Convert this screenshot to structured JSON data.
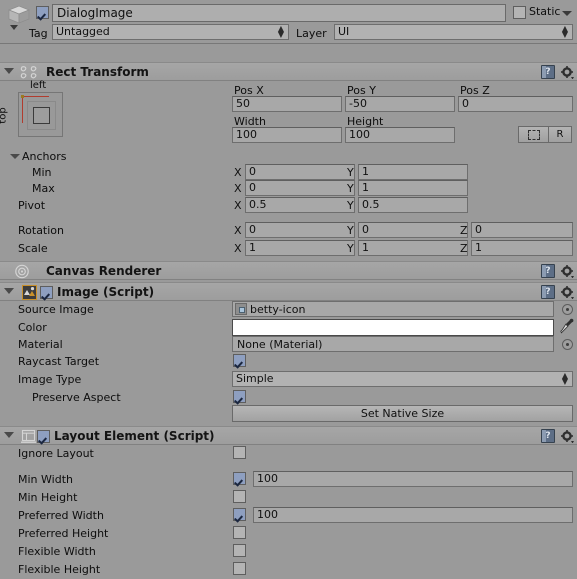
{
  "header": {
    "icon": "cube-icon",
    "enabled": true,
    "name": "DialogImage",
    "static_label": "Static",
    "static_checked": false,
    "tag_label": "Tag",
    "tag_value": "Untagged",
    "layer_label": "Layer",
    "layer_value": "UI"
  },
  "rect_transform": {
    "title": "Rect Transform",
    "anchor_preset_left": "left",
    "anchor_preset_top": "top",
    "pos_x_label": "Pos X",
    "pos_y_label": "Pos Y",
    "pos_z_label": "Pos Z",
    "pos_x": "50",
    "pos_y": "-50",
    "pos_z": "0",
    "width_label": "Width",
    "height_label": "Height",
    "width": "100",
    "height": "100",
    "blueprint_button": "blueprint-icon",
    "raw_button": "R",
    "anchors_label": "Anchors",
    "min_label": "Min",
    "min_x": "0",
    "min_y": "1",
    "max_label": "Max",
    "max_x": "0",
    "max_y": "1",
    "pivot_label": "Pivot",
    "pivot_x": "0.5",
    "pivot_y": "0.5",
    "rotation_label": "Rotation",
    "rot_x": "0",
    "rot_y": "0",
    "rot_z": "0",
    "scale_label": "Scale",
    "scale_x": "1",
    "scale_y": "1",
    "scale_z": "1",
    "axis_x": "X",
    "axis_y": "Y",
    "axis_z": "Z"
  },
  "canvas_renderer": {
    "title": "Canvas Renderer"
  },
  "image": {
    "title": "Image (Script)",
    "enabled": true,
    "source_image_label": "Source Image",
    "source_image_value": "betty-icon",
    "color_label": "Color",
    "color_value": "#FFFFFF",
    "material_label": "Material",
    "material_value": "None (Material)",
    "raycast_label": "Raycast Target",
    "raycast_checked": true,
    "image_type_label": "Image Type",
    "image_type_value": "Simple",
    "preserve_aspect_label": "Preserve Aspect",
    "preserve_aspect_checked": true,
    "set_native_size_label": "Set Native Size"
  },
  "layout_element": {
    "title": "Layout Element (Script)",
    "enabled": true,
    "rows": [
      {
        "label": "Ignore Layout",
        "checked": false,
        "value": ""
      },
      {
        "label": "Min Width",
        "checked": true,
        "value": "100"
      },
      {
        "label": "Min Height",
        "checked": false,
        "value": ""
      },
      {
        "label": "Preferred Width",
        "checked": true,
        "value": "100"
      },
      {
        "label": "Preferred Height",
        "checked": false,
        "value": ""
      },
      {
        "label": "Flexible Width",
        "checked": false,
        "value": ""
      },
      {
        "label": "Flexible Height",
        "checked": false,
        "value": ""
      }
    ]
  },
  "colors": {
    "background": "#9a9a9a",
    "field": "#a8a8a8",
    "header": "#a3a3a3",
    "checkbox_on": "#8e9fc0",
    "anchor_red": "#b13c2e"
  }
}
